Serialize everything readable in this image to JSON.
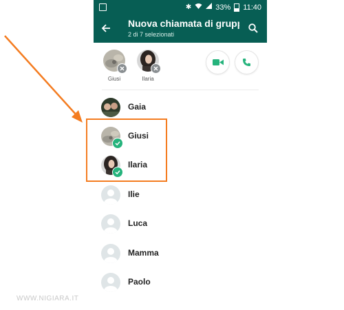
{
  "status_bar": {
    "battery": "33%",
    "time": "11:40"
  },
  "app_bar": {
    "title": "Nuova chiamata di gruppo",
    "subtitle": "2 di 7 selezionati"
  },
  "selected": [
    {
      "name": "Giusi"
    },
    {
      "name": "Ilaria"
    }
  ],
  "contacts": [
    {
      "name": "Gaia",
      "selected": false
    },
    {
      "name": "Giusi",
      "selected": true
    },
    {
      "name": "Ilaria",
      "selected": true
    },
    {
      "name": "Ilie",
      "selected": false
    },
    {
      "name": "Luca",
      "selected": false
    },
    {
      "name": "Mamma",
      "selected": false
    },
    {
      "name": "Paolo",
      "selected": false
    }
  ],
  "watermark": "WWW.NIGIARA.IT",
  "colors": {
    "app_bar": "#075e54",
    "accent": "#25b37c",
    "highlight": "#f47c20"
  },
  "icons": {
    "back": "arrow-left-icon",
    "search": "search-icon",
    "video": "video-camera-icon",
    "voice": "phone-icon"
  }
}
